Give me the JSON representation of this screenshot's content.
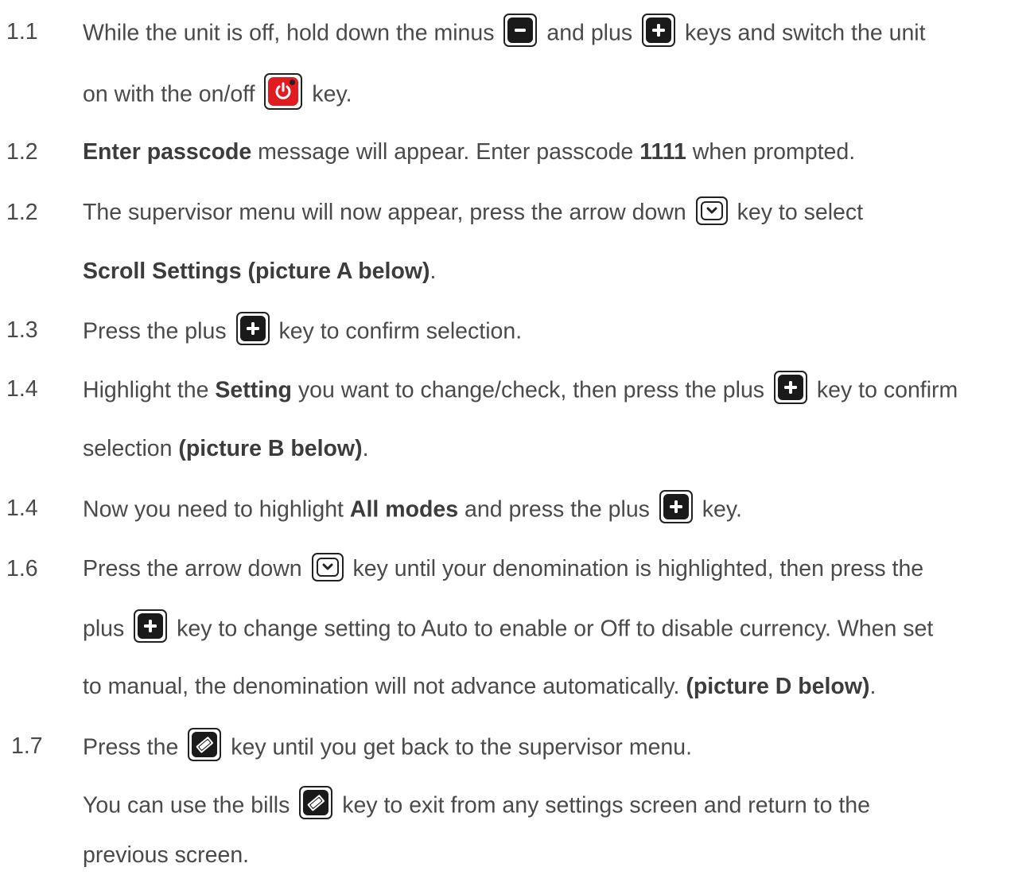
{
  "steps": [
    {
      "num": "1.1",
      "l1_a": "While the unit is off, hold down the minus",
      "l1_b": "and plus",
      "l1_c": "keys and switch the unit",
      "l2_a": "on with the on/off",
      "l2_b": "key."
    },
    {
      "num": "1.2",
      "bold_a": "Enter passcode",
      "text_a": " message will appear. Enter passcode ",
      "bold_b": "1111",
      "text_b": " when prompted."
    },
    {
      "num": "1.2",
      "l1_a": "The supervisor menu will now appear, press the arrow down",
      "l1_b": "key to select",
      "l2_bold": "Scroll Settings (picture A below)",
      "l2_end": "."
    },
    {
      "num": "1.3",
      "a": "Press the plus",
      "b": "key to confirm selection."
    },
    {
      "num": "1.4",
      "l1_a": "Highlight the ",
      "l1_bold": "Setting",
      "l1_b": " you want to change/check, then press the plus",
      "l1_c": "key to confirm",
      "l2_a": "selection ",
      "l2_bold": "(picture B below)",
      "l2_end": "."
    },
    {
      "num": "1.4",
      "a": "Now you need to highlight ",
      "bold": "All modes",
      "b": " and press the plus",
      "c": "key."
    },
    {
      "num": "1.6",
      "l1_a": "Press the arrow down",
      "l1_b": "key until your denomination is highlighted, then press the",
      "l2_a": "plus",
      "l2_b": "key to change setting to Auto to enable or Off to disable currency. When set",
      "l3_a": "to manual, the denomination will not advance automatically. ",
      "l3_bold": "(picture D below)",
      "l3_end": "."
    },
    {
      "num": "1.7",
      "l1_a": "Press the",
      "l1_b": "key until you get back to the supervisor menu.",
      "l2_a": "You can use the bills",
      "l2_b": "key to exit from any settings screen and return to the",
      "l3": "previous screen."
    }
  ],
  "icons": {
    "minus": "minus-key-icon",
    "plus": "plus-key-icon",
    "power": "power-key-icon",
    "arrow_down": "arrow-down-key-icon",
    "bills": "bills-key-icon"
  },
  "colors": {
    "text": "#4a4a4a",
    "power_key": "#e01b22",
    "key_dark": "#1a1a1a"
  }
}
